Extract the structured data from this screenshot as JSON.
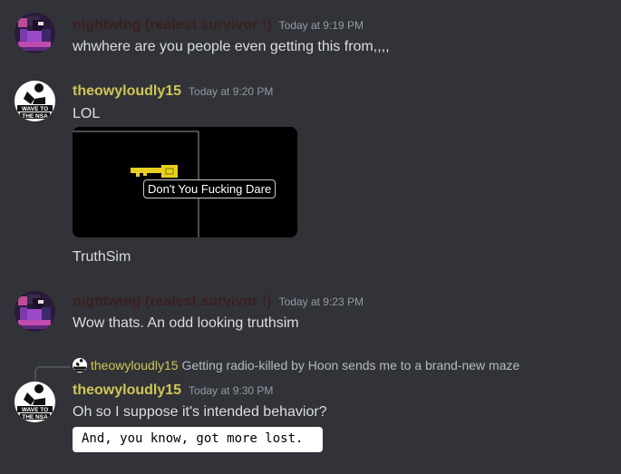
{
  "messages": [
    {
      "username": "nightwing (realest survivor !)",
      "timestamp": "Today at 9:19 PM",
      "content": "whwhere are you people even getting this from,,,,"
    },
    {
      "username": "theowyloudly15",
      "timestamp": "Today at 9:20 PM",
      "content": "LOL",
      "image_tooltip": "Don't You Fucking Dare",
      "caption": "TruthSim"
    },
    {
      "username": "nightwing (realest survivor !)",
      "timestamp": "Today at 9:23 PM",
      "content": "Wow thats. An odd looking truthsim"
    },
    {
      "reply": {
        "username": "theowyloudly15",
        "text": "Getting radio-killed by Hoon sends me to a brand-new maze"
      },
      "username": "theowyloudly15",
      "timestamp": "Today at 9:30 PM",
      "content": "Oh so I suppose it's intended behavior?",
      "code_image_text": "And, you know, got more lost."
    }
  ],
  "avatars": {
    "nightwing": "pixel-art-creature-avatar",
    "theowyloudly15": "wave-to-the-nsa-avatar"
  },
  "theowy_avatar_text": [
    "WAVE TO",
    "THE NSA"
  ],
  "colors": {
    "background": "#313338",
    "text": "#dbdee1",
    "timestamp": "#949ba4",
    "username_yellow": "#d0c655",
    "username_dark": "#3b1f1f"
  }
}
